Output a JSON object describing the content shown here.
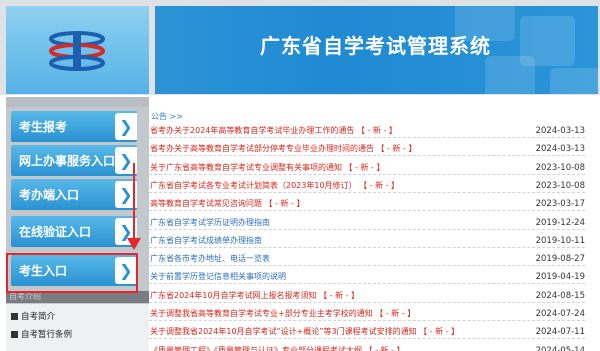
{
  "header": {
    "title": "广东省自学考试管理系统",
    "logo": "provincial-exam-logo"
  },
  "sidebar": {
    "buttons": [
      {
        "label": "考生报考"
      },
      {
        "label": "网上办事服务入口"
      },
      {
        "label": "考办端入口"
      },
      {
        "label": "在线验证入口"
      },
      {
        "label": "考生入口"
      }
    ],
    "section_label": "自考介绍",
    "sub_items": [
      {
        "label": "自考简介"
      },
      {
        "label": "自考暂行条例"
      }
    ]
  },
  "content": {
    "breadcrumb": "公告 >>",
    "notices": [
      {
        "title": "省考办关于2024年高等教育自学考试毕业办理工作的通告",
        "tag": "【 - 新 - 】",
        "date": "2024-03-13",
        "color": "#d9261c"
      },
      {
        "title": "省考办关于高等教育自学考试部分停考专业毕业办理时间的通告",
        "tag": "【 - 新 - 】",
        "date": "2024-03-13",
        "color": "#d9261c"
      },
      {
        "title": "关于广东省高等教育自学考试专业调整有关事项的通知",
        "tag": "【 - 新 - 】",
        "date": "2023-10-08",
        "color": "#d9261c"
      },
      {
        "title": "广东省自学考试各专业考试计划简表（2023年10月修订）",
        "tag": "【 - 新 - 】",
        "date": "2023-10-08",
        "color": "#d9261c"
      },
      {
        "title": "高等教育自学考试常见咨询问题",
        "tag": "【 - 新 - 】",
        "date": "2023-03-17",
        "color": "#d9261c"
      },
      {
        "title": "广东省自学考试学历证明办理指南",
        "tag": "",
        "date": "2019-12-24",
        "color": "#2a6fbd"
      },
      {
        "title": "广东省自学考试成绩单办理指南",
        "tag": "",
        "date": "2019-10-11",
        "color": "#2a6fbd"
      },
      {
        "title": "广东省各市考办地址、电话一览表",
        "tag": "",
        "date": "2019-08-27",
        "color": "#2a6fbd"
      },
      {
        "title": "关于前置学历登记信息相关事项的说明",
        "tag": "",
        "date": "2019-04-19",
        "color": "#2a6fbd"
      },
      {
        "title": "广东省2024年10月自学考试网上报名报考须知",
        "tag": "【 - 新 - 】",
        "date": "2024-08-15",
        "color": "#d9261c"
      },
      {
        "title": "关于调整我省高等教育自学考试专业+部分专业主考学校的通知",
        "tag": "【 - 新 - 】",
        "date": "2024-07-24",
        "color": "#d9261c"
      },
      {
        "title": "关于调整我省2024年10月自学考试“设计+概论”等3门课程考试安排的通知",
        "tag": "【 - 新 - 】",
        "date": "2024-07-11",
        "color": "#d9261c"
      },
      {
        "title": "《质量管理工程》《质量管理与认证》专业部分课程考试大纲",
        "tag": "【 - 新 - 】",
        "date": "2024-05-14",
        "color": "#d9261c"
      }
    ]
  },
  "colors": {
    "accent_blue": "#2a92d2",
    "highlight_red": "#e8252b"
  }
}
